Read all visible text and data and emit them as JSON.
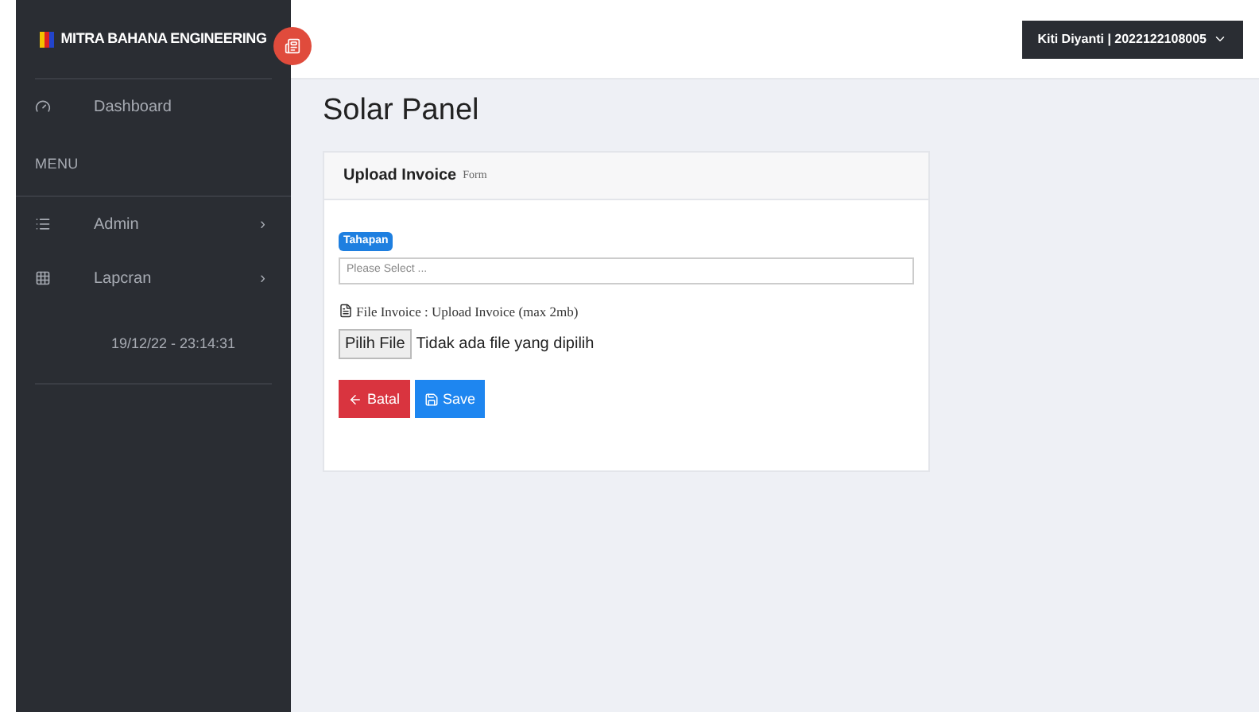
{
  "brand": "MITRA BAHANA ENGINEERING",
  "user_menu": "Kiti Diyanti | 2022122108005",
  "sidebar": {
    "items": [
      {
        "kind": "link",
        "label": "Dashboard"
      },
      {
        "kind": "header",
        "label": "MENU"
      },
      {
        "kind": "link",
        "label": "Admin",
        "arrow": "›"
      },
      {
        "kind": "link",
        "label": "Lapcran",
        "arrow": "›"
      },
      {
        "kind": "clock",
        "label": "19/12/22 - 23:14:31"
      }
    ]
  },
  "page_title": "Solar Panel",
  "card": {
    "title": "Upload Invoice",
    "subtitle": "Form",
    "select_label": "Tahapan",
    "select_placeholder": "Please Select ...",
    "file_label": "File Invoice : Upload Invoice (max 2mb)",
    "file_button": "Pilih File",
    "file_status": "Tidak ada file yang dipilih",
    "buttons": [
      {
        "kind": "cancel",
        "label": "Batal"
      },
      {
        "kind": "save",
        "label": "Save"
      }
    ]
  }
}
